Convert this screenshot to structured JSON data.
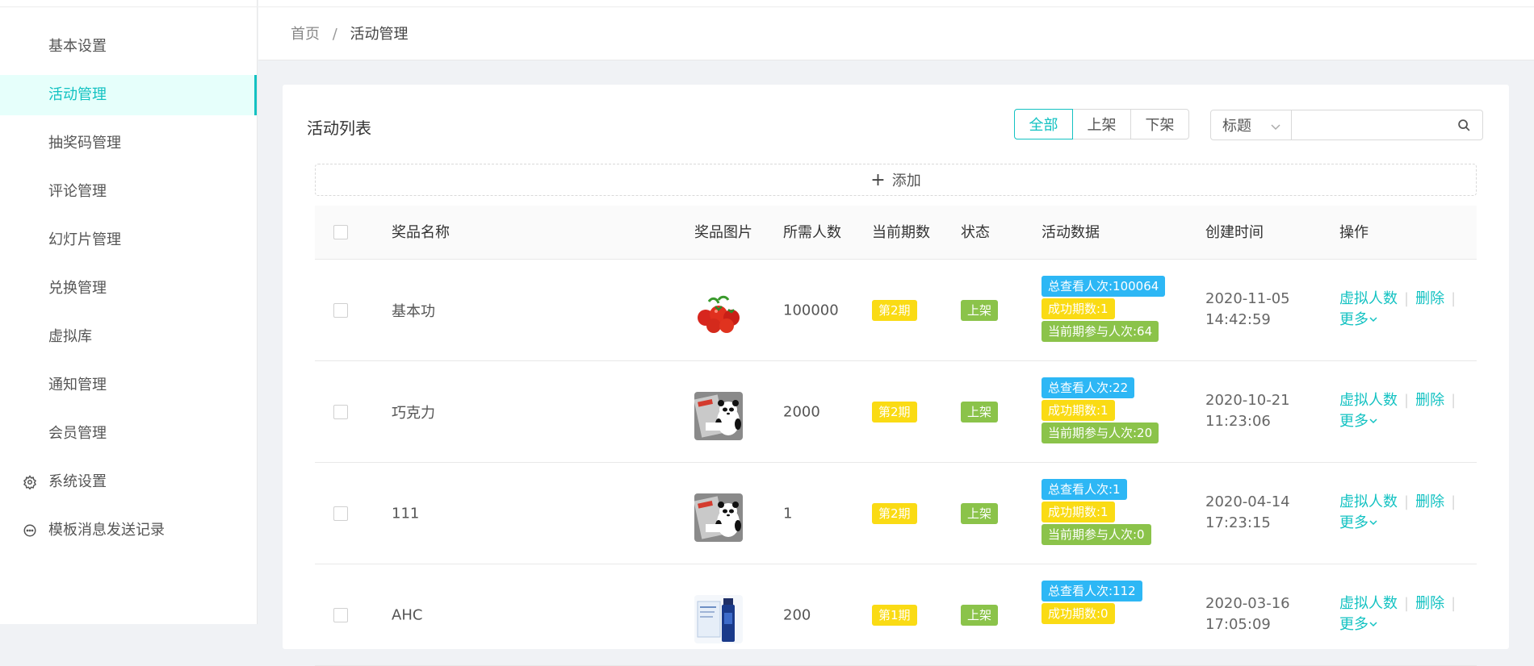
{
  "sidebar": {
    "items": [
      {
        "label": "基本设置",
        "icon": "",
        "active": false
      },
      {
        "label": "活动管理",
        "icon": "",
        "active": true
      },
      {
        "label": "抽奖码管理",
        "icon": "",
        "active": false
      },
      {
        "label": "评论管理",
        "icon": "",
        "active": false
      },
      {
        "label": "幻灯片管理",
        "icon": "",
        "active": false
      },
      {
        "label": "兑换管理",
        "icon": "",
        "active": false
      },
      {
        "label": "虚拟库",
        "icon": "",
        "active": false
      },
      {
        "label": "通知管理",
        "icon": "",
        "active": false
      },
      {
        "label": "会员管理",
        "icon": "",
        "active": false
      },
      {
        "label": "系统设置",
        "icon": "gear-icon",
        "active": false
      },
      {
        "label": "模板消息发送记录",
        "icon": "message-icon",
        "active": false
      }
    ]
  },
  "breadcrumb": {
    "home": "首页",
    "separator": "/",
    "current": "活动管理"
  },
  "card": {
    "title": "活动列表",
    "filters": [
      {
        "label": "全部",
        "active": true
      },
      {
        "label": "上架",
        "active": false
      },
      {
        "label": "下架",
        "active": false
      }
    ],
    "search": {
      "field": "标题",
      "placeholder": "",
      "value": ""
    },
    "add_label": "添加"
  },
  "table": {
    "headers": [
      "奖品名称",
      "奖品图片",
      "所需人数",
      "当前期数",
      "状态",
      "活动数据",
      "创建时间",
      "操作"
    ],
    "rows": [
      {
        "name": "基本功",
        "image": "tomato-image",
        "required": "100000",
        "period": "第2期",
        "status": "上架",
        "stats": [
          "总查看人次:100064",
          "成功期数:1",
          "当前期参与人次:64"
        ],
        "date": "2020-11-05",
        "time": "14:42:59"
      },
      {
        "name": "巧克力",
        "image": "panda-image",
        "required": "2000",
        "period": "第2期",
        "status": "上架",
        "stats": [
          "总查看人次:22",
          "成功期数:1",
          "当前期参与人次:20"
        ],
        "date": "2020-10-21",
        "time": "11:23:06"
      },
      {
        "name": "111",
        "image": "panda-image",
        "required": "1",
        "period": "第2期",
        "status": "上架",
        "stats": [
          "总查看人次:1",
          "成功期数:1",
          "当前期参与人次:0"
        ],
        "date": "2020-04-14",
        "time": "17:23:15"
      },
      {
        "name": "AHC",
        "image": "bottle-image",
        "required": "200",
        "period": "第1期",
        "status": "上架",
        "stats": [
          "总查看人次:112",
          "成功期数:0",
          ""
        ],
        "date": "2020-03-16",
        "time": "17:05:09"
      }
    ],
    "actions": {
      "virtual": "虚拟人数",
      "delete": "删除",
      "more": "更多"
    }
  },
  "colors": {
    "accent": "#13c2c2",
    "tag_gold": "#fadb14",
    "tag_green": "#8bc34a",
    "tag_blue": "#2db7f5"
  }
}
